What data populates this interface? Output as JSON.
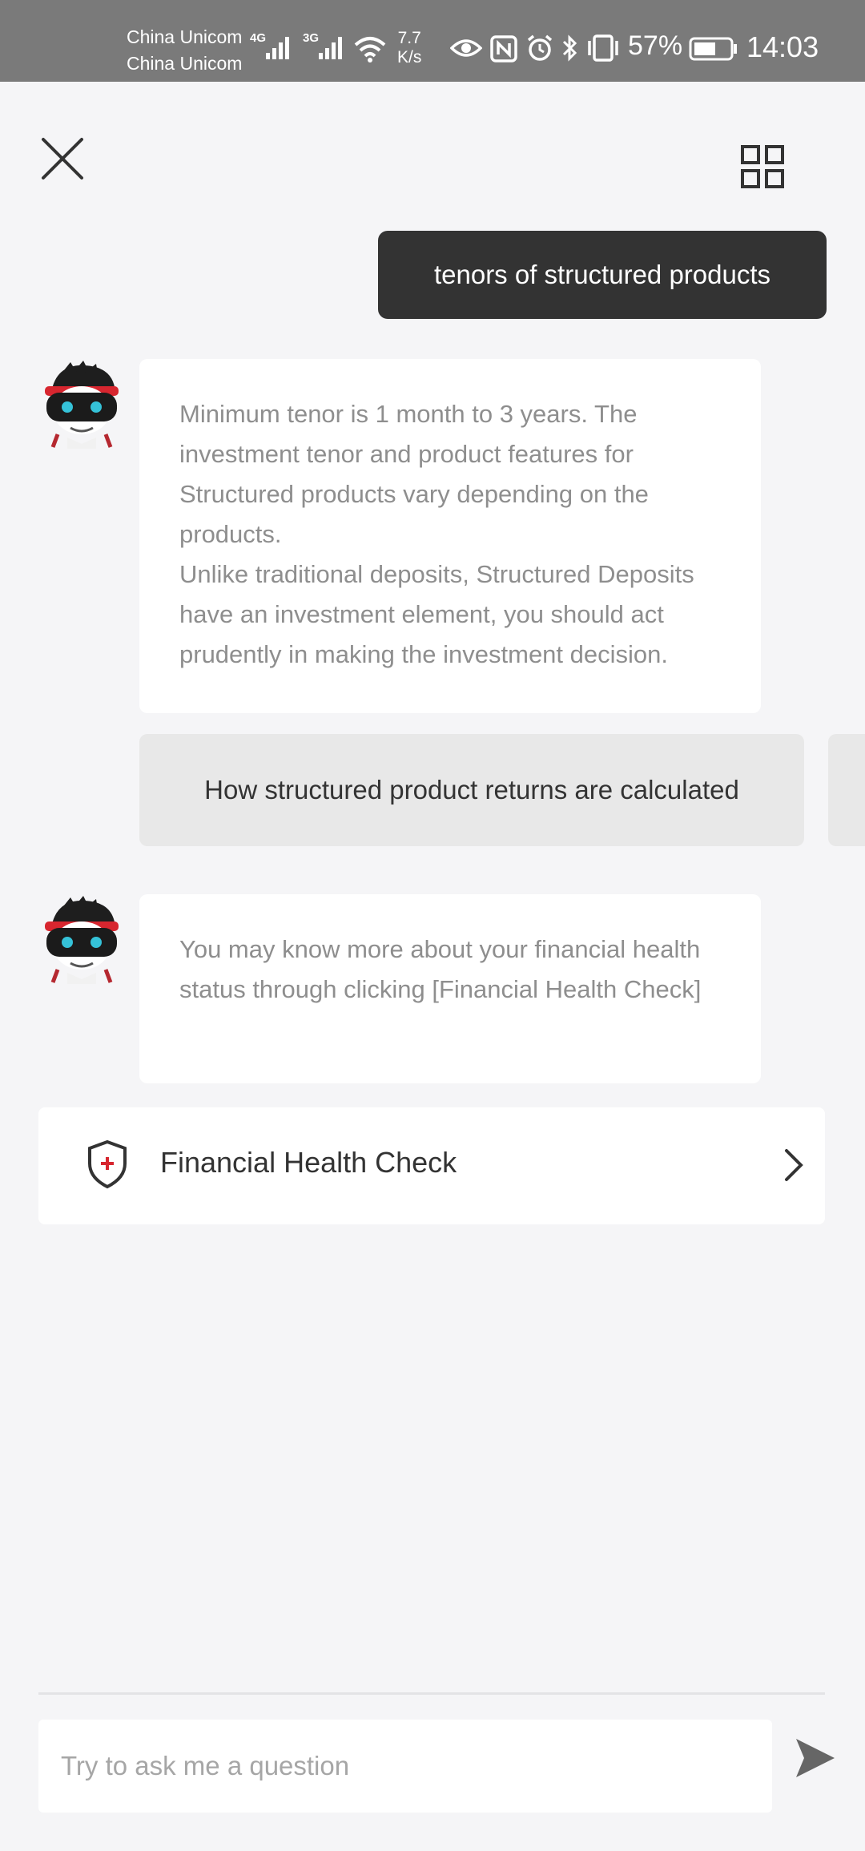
{
  "status_bar": {
    "carrier_1": "China Unicom",
    "carrier_2": "China Unicom",
    "net_1": "4G",
    "net_2": "3G",
    "speed_value": "7.7",
    "speed_unit": "K/s",
    "battery_percent": "57%",
    "time": "14:03"
  },
  "header": {
    "close_icon": "close-icon",
    "menu_icon": "grid-icon"
  },
  "chat": {
    "user_message": "tenors of structured products",
    "bot_message_1_line_1": "Minimum tenor is 1 month to 3 years. The investment tenor and product features for Structured products vary depending on the products.",
    "bot_message_1_line_2": "Unlike traditional deposits, Structured Deposits have an investment element, you should act prudently in making the investment decision.",
    "suggestion": "How structured product returns are calculated",
    "bot_message_2": "You may know more about your financial health status through clicking [Financial Health Check]",
    "card_label": "Financial Health Check"
  },
  "composer": {
    "placeholder": "Try to ask me a question"
  },
  "colors": {
    "user_bubble": "#333333",
    "background": "#f5f5f7",
    "accent_red": "#d7262f"
  }
}
